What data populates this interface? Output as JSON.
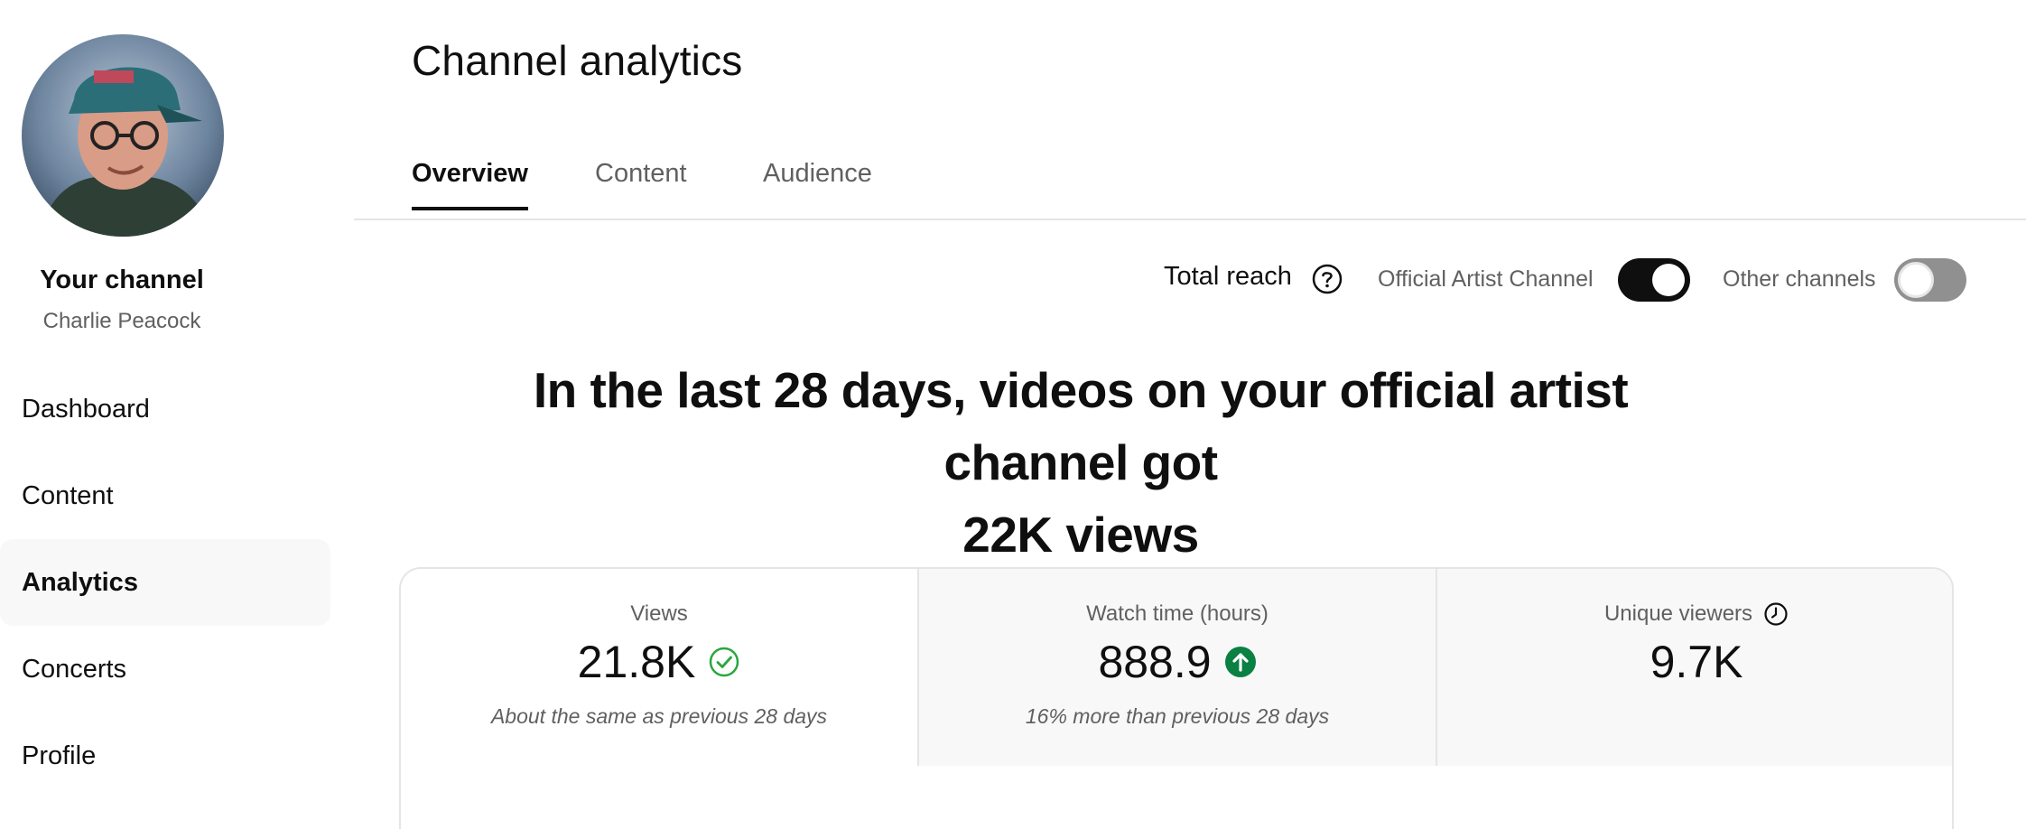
{
  "sidebar": {
    "channel_heading": "Your channel",
    "channel_name": "Charlie Peacock",
    "items": [
      {
        "label": "Dashboard"
      },
      {
        "label": "Content"
      },
      {
        "label": "Analytics",
        "active": true
      },
      {
        "label": "Concerts"
      },
      {
        "label": "Profile"
      }
    ]
  },
  "header": {
    "title": "Channel analytics"
  },
  "tabs": [
    {
      "label": "Overview",
      "active": true
    },
    {
      "label": "Content"
    },
    {
      "label": "Audience"
    }
  ],
  "reach": {
    "label": "Total reach",
    "help_icon": "help-circle-icon",
    "official_artist_channel": {
      "label": "Official Artist Channel",
      "on": true
    },
    "other_channels": {
      "label": "Other channels",
      "on": false
    }
  },
  "headline": {
    "line1": "In the last 28 days, videos on your official artist channel got",
    "line2": "22K views"
  },
  "metrics": [
    {
      "label": "Views",
      "value": "21.8K",
      "icon": "check-circle-icon",
      "note": "About the same as previous 28 days"
    },
    {
      "label": "Watch time (hours)",
      "value": "888.9",
      "icon": "arrow-up-circle-icon",
      "note": "16% more than previous 28 days"
    },
    {
      "label": "Unique viewers",
      "value": "9.7K",
      "icon": "clock-icon",
      "note": ""
    }
  ],
  "colors": {
    "text": "#0f0f0f",
    "secondary_text": "#606060",
    "positive_green": "#0b8043",
    "check_green": "#2ba640",
    "toggle_on": "#0f0f0f",
    "toggle_off": "#909090",
    "border": "#e5e5e5",
    "card_bg": "#f8f8f8"
  }
}
